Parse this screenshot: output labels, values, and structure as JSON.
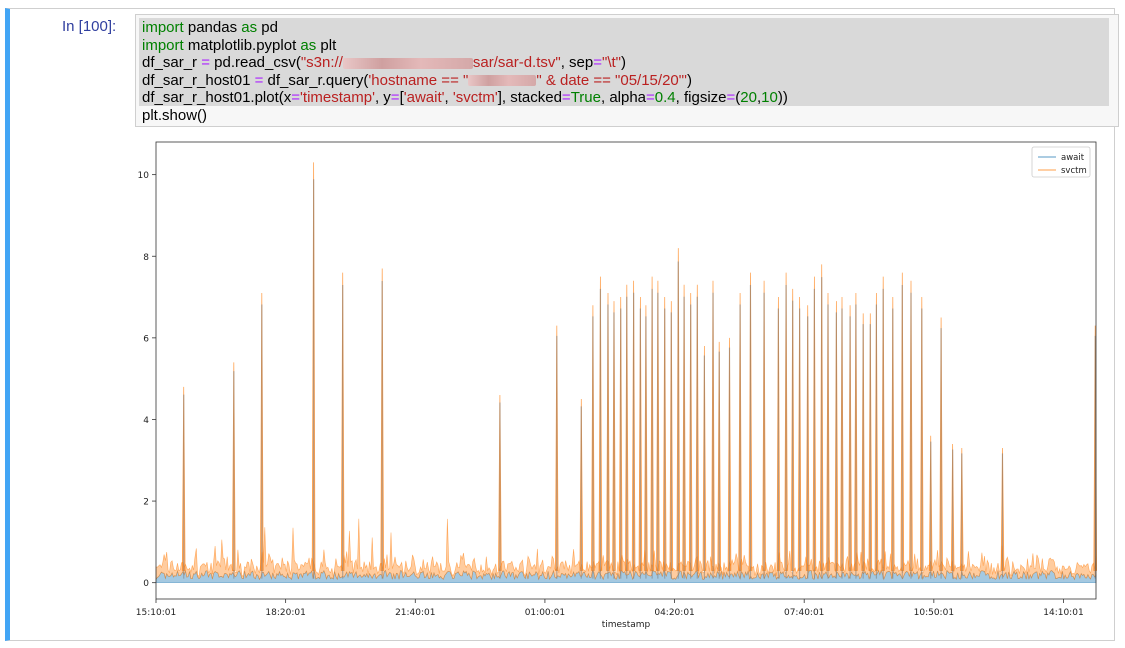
{
  "cell": {
    "prompt": "In [100]:",
    "code_lines": [
      [
        [
          "kw",
          "import"
        ],
        [
          "t",
          " pandas "
        ],
        [
          "kw",
          "as"
        ],
        [
          "t",
          " pd"
        ]
      ],
      [
        [
          "kw",
          "import"
        ],
        [
          "t",
          " matplotlib.pyplot "
        ],
        [
          "kw",
          "as"
        ],
        [
          "t",
          " plt"
        ]
      ],
      [
        [
          "t",
          "df_sar_r "
        ],
        [
          "op",
          "="
        ],
        [
          "t",
          " pd.read_csv("
        ],
        [
          "str",
          "\"s3n://"
        ],
        [
          "blur",
          "130"
        ],
        [
          "str",
          "sar/sar-d.tsv\""
        ],
        [
          "t",
          ", sep"
        ],
        [
          "op",
          "="
        ],
        [
          "str",
          "\"\\t\""
        ],
        [
          "t",
          ")"
        ]
      ],
      [
        [
          "t",
          "df_sar_r_host01 "
        ],
        [
          "op",
          "="
        ],
        [
          "t",
          " df_sar_r.query("
        ],
        [
          "str",
          "'hostname == \""
        ],
        [
          "blur",
          "68"
        ],
        [
          "str",
          "\" & date == \"05/15/20\"'"
        ],
        [
          "t",
          ")"
        ]
      ],
      [
        [
          "t",
          "df_sar_r_host01.plot(x"
        ],
        [
          "op",
          "="
        ],
        [
          "str",
          "'timestamp'"
        ],
        [
          "t",
          ", y"
        ],
        [
          "op",
          "="
        ],
        [
          "t",
          "["
        ],
        [
          "str",
          "'await'"
        ],
        [
          "t",
          ", "
        ],
        [
          "str",
          "'svctm'"
        ],
        [
          "t",
          "], stacked"
        ],
        [
          "op",
          "="
        ],
        [
          "kw",
          "True"
        ],
        [
          "t",
          ", alpha"
        ],
        [
          "op",
          "="
        ],
        [
          "num",
          "0.4"
        ],
        [
          "t",
          ", figsize"
        ],
        [
          "op",
          "="
        ],
        [
          "t",
          "("
        ],
        [
          "num",
          "20"
        ],
        [
          "t",
          ","
        ],
        [
          "num",
          "10"
        ],
        [
          "t",
          "))"
        ]
      ],
      [
        [
          "t",
          "plt.show()"
        ]
      ]
    ]
  },
  "chart_data": {
    "type": "area",
    "stacked": true,
    "alpha": 0.4,
    "xlabel": "timestamp",
    "x_tick_labels": [
      "15:10:01",
      "18:20:01",
      "21:40:01",
      "01:00:01",
      "04:20:01",
      "07:40:01",
      "10:50:01",
      "14:10:01"
    ],
    "ylim": [
      -0.4,
      10.8
    ],
    "y_ticks": [
      0,
      2,
      4,
      6,
      8,
      10
    ],
    "legend": "top-right",
    "colors": {
      "await": "#1f77b4",
      "svctm": "#ff7f0e"
    },
    "series": [
      {
        "name": "await"
      },
      {
        "name": "svctm"
      }
    ],
    "baseline_level": 0.25,
    "spikes_x_fraction": [
      0.0295,
      0.0828,
      0.1126,
      0.1677,
      0.1986,
      0.2406,
      0.3659,
      0.4264,
      0.4524,
      0.4648,
      0.4728,
      0.4808,
      0.4872,
      0.4944,
      0.5008,
      0.5081,
      0.5153,
      0.5212,
      0.5278,
      0.5339,
      0.5412,
      0.5482,
      0.5556,
      0.5618,
      0.5688,
      0.5758,
      0.5834,
      0.5926,
      0.5992,
      0.6101,
      0.6214,
      0.6324,
      0.6469,
      0.6621,
      0.6703,
      0.6773,
      0.6847,
      0.6933,
      0.7004,
      0.7082,
      0.7149,
      0.7238,
      0.7298,
      0.7384,
      0.7446,
      0.7523,
      0.7599,
      0.7664,
      0.7736,
      0.7838,
      0.7939,
      0.8032,
      0.8147,
      0.8242,
      0.8352,
      0.8475,
      0.8572,
      0.9005,
      0.9992
    ],
    "spikes_value": [
      4.8,
      5.4,
      7.1,
      10.3,
      7.6,
      7.7,
      4.6,
      6.3,
      4.5,
      6.8,
      7.5,
      7.1,
      6.9,
      7.0,
      7.3,
      7.4,
      7.0,
      6.8,
      7.5,
      7.4,
      7.0,
      6.9,
      8.2,
      7.3,
      7.1,
      7.3,
      5.8,
      7.4,
      5.9,
      6.0,
      7.1,
      7.6,
      7.4,
      7.0,
      7.6,
      7.2,
      7.0,
      6.8,
      7.5,
      7.8,
      7.1,
      6.9,
      7.0,
      6.8,
      7.1,
      6.6,
      6.6,
      7.1,
      7.5,
      7.0,
      7.6,
      7.4,
      7.0,
      3.6,
      6.5,
      3.4,
      3.3,
      3.3,
      6.3
    ]
  }
}
